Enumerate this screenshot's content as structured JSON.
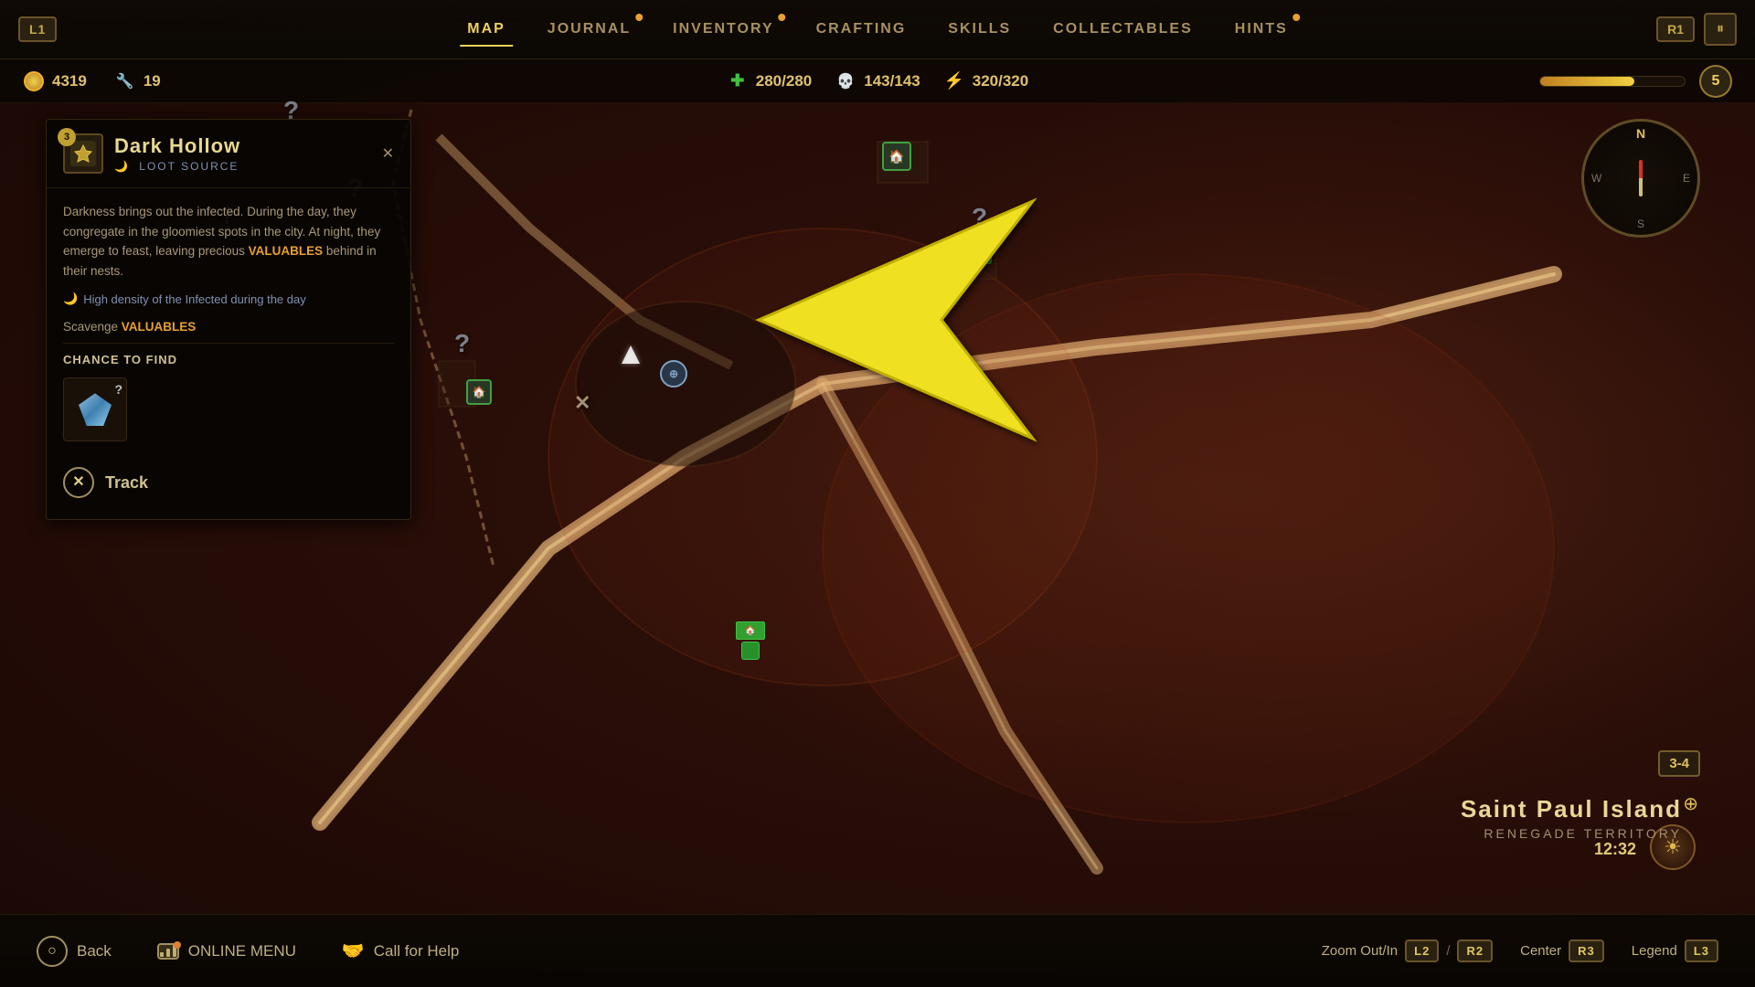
{
  "nav": {
    "l1": "L1",
    "r1": "R1",
    "tabs": [
      {
        "label": "MAP",
        "active": true,
        "dot": false
      },
      {
        "label": "JOURNAL",
        "active": false,
        "dot": true
      },
      {
        "label": "INVENTORY",
        "active": false,
        "dot": true
      },
      {
        "label": "CRAFTING",
        "active": false,
        "dot": false
      },
      {
        "label": "SKILLS",
        "active": false,
        "dot": false
      },
      {
        "label": "COLLECTABLES",
        "active": false,
        "dot": false
      },
      {
        "label": "HINTS",
        "active": false,
        "dot": true
      }
    ],
    "pause": "⏸"
  },
  "stats": {
    "gold": "4319",
    "tools": "19",
    "health_current": "280",
    "health_max": "280",
    "skull_current": "143",
    "skull_max": "143",
    "stamina_current": "320",
    "stamina_max": "320",
    "level": "5"
  },
  "location_panel": {
    "title": "Dark Hollow",
    "subtitle": "LOOT SOURCE",
    "level": "3",
    "description": "Darkness brings out the infected. During the day, they congregate in the gloomiest spots in the city. At night, they emerge to feast, leaving precious VALUABLES behind in their nests.",
    "note": "High density of the Infected during the day",
    "scavenge": "Scavenge VALUABLES",
    "chance_header": "CHANCE TO FIND",
    "track_label": "Track"
  },
  "map_ui": {
    "compass": {
      "n": "N",
      "s": "S",
      "w": "W",
      "e": "E"
    },
    "location_name": "Saint Paul Island",
    "location_type": "RENEGADE TERRITORY",
    "zone": "3-4",
    "time": "12:32"
  },
  "bottom_bar": {
    "back": "Back",
    "online_menu": "ONLINE MENU",
    "call_for_help": "Call for Help",
    "zoom_label": "Zoom Out/In",
    "zoom_l2": "L2",
    "zoom_r2": "R2",
    "center_label": "Center",
    "center_btn": "R3",
    "legend_label": "Legend",
    "legend_btn": "L3"
  },
  "colors": {
    "accent": "#f0d060",
    "valuables": "#e8a030",
    "health": "#30c030",
    "stamina": "#50a0e0",
    "moon": "#8090b0",
    "bg_dark": "#08050302"
  }
}
